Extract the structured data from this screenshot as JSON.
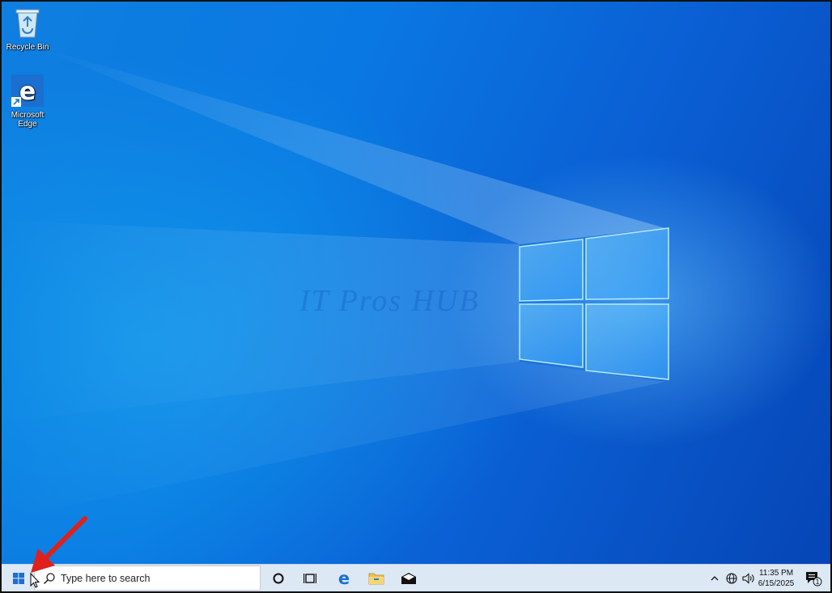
{
  "desktop": {
    "icons": [
      {
        "label": "Recycle Bin",
        "icon": "recycle-bin-icon"
      },
      {
        "label": "Microsoft Edge",
        "icon": "edge-icon"
      }
    ],
    "wallpaper": "windows-10-hero-light",
    "watermark": "IT Pros HUB"
  },
  "taskbar": {
    "start_icon": "windows-logo-icon",
    "search": {
      "placeholder": "Type here to search",
      "icon": "search-icon"
    },
    "buttons": [
      {
        "name": "cortana",
        "icon": "cortana-circle-icon"
      },
      {
        "name": "task-view",
        "icon": "task-view-icon"
      },
      {
        "name": "edge",
        "icon": "edge-icon"
      },
      {
        "name": "file-explorer",
        "icon": "folder-icon"
      },
      {
        "name": "mail",
        "icon": "mail-icon"
      }
    ],
    "tray": {
      "icons": [
        "chevron-up-icon",
        "network-globe-icon",
        "volume-icon"
      ],
      "time": "11:35 PM",
      "date": "6/15/2025",
      "notification_count": "1"
    }
  },
  "colors": {
    "desktop_primary": "#0a78e2",
    "taskbar_bg": "#dce8f3",
    "annotation_arrow": "#e0201b"
  }
}
